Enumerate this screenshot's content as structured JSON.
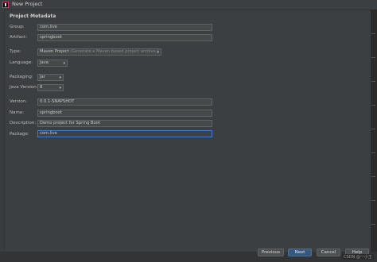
{
  "window": {
    "title": "New Project"
  },
  "section": {
    "title": "Project Metadata"
  },
  "fields": {
    "group": {
      "label": "Group:",
      "value": "com.live"
    },
    "artifact": {
      "label": "Artifact:",
      "value": "springboot"
    },
    "type": {
      "label": "Type:",
      "value": "Maven Project",
      "hint": "(Generate a Maven based project archive.)"
    },
    "language": {
      "label": "Language:",
      "value": "Java"
    },
    "packaging": {
      "label": "Packaging:",
      "value": "Jar"
    },
    "java_version": {
      "label": "Java Version:",
      "value": "8"
    },
    "version": {
      "label": "Version:",
      "value": "0.0.1-SNAPSHOT"
    },
    "name": {
      "label": "Name:",
      "value": "springboot"
    },
    "description": {
      "label": "Description:",
      "value": "Demo project for Spring Boot"
    },
    "package": {
      "label": "Package:",
      "value": "com.live"
    }
  },
  "buttons": {
    "previous": "Previous",
    "next": "Next",
    "cancel": "Cancel",
    "help": "Help"
  },
  "watermark": "CSDN @一小王"
}
